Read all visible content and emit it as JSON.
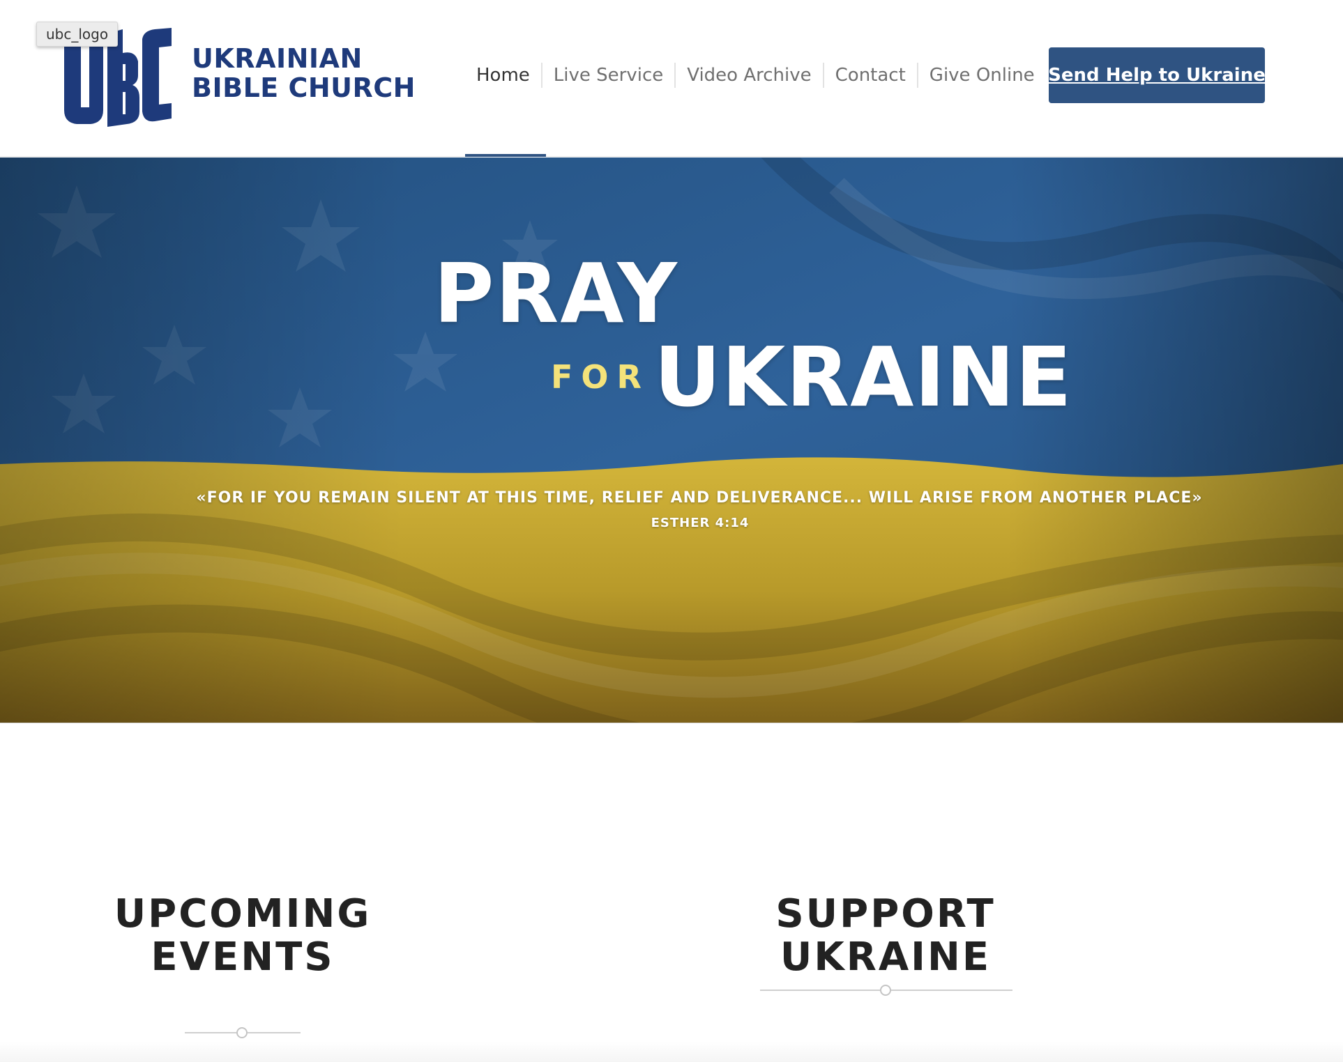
{
  "header": {
    "logo": {
      "tooltip": "ubc_logo",
      "line1": "UKRAINIAN",
      "line2": "BIBLE CHURCH",
      "color": "#1e3a7b"
    },
    "nav": {
      "items": [
        {
          "label": "Home",
          "active": true
        },
        {
          "label": "Live Service",
          "active": false
        },
        {
          "label": "Video Archive",
          "active": false
        },
        {
          "label": "Contact",
          "active": false
        },
        {
          "label": "Give Online",
          "active": false
        }
      ],
      "cta": "Send Help to Ukraine",
      "accent": "#2f5382"
    }
  },
  "hero": {
    "title_line1": "PRAY",
    "title_for": "FOR",
    "title_line2": "UKRAINE",
    "quote": "«FOR IF YOU REMAIN SILENT AT THIS TIME, RELIEF AND DELIVERANCE... WILL ARISE FROM ANOTHER PLACE»",
    "citation": "ESTHER 4:14",
    "flag_blue": "#2c5b8e",
    "flag_yellow": "#c4a52f"
  },
  "sections": {
    "events_line1": "UPCOMING",
    "events_line2": "EVENTS",
    "support": "SUPPORT UKRAINE"
  }
}
